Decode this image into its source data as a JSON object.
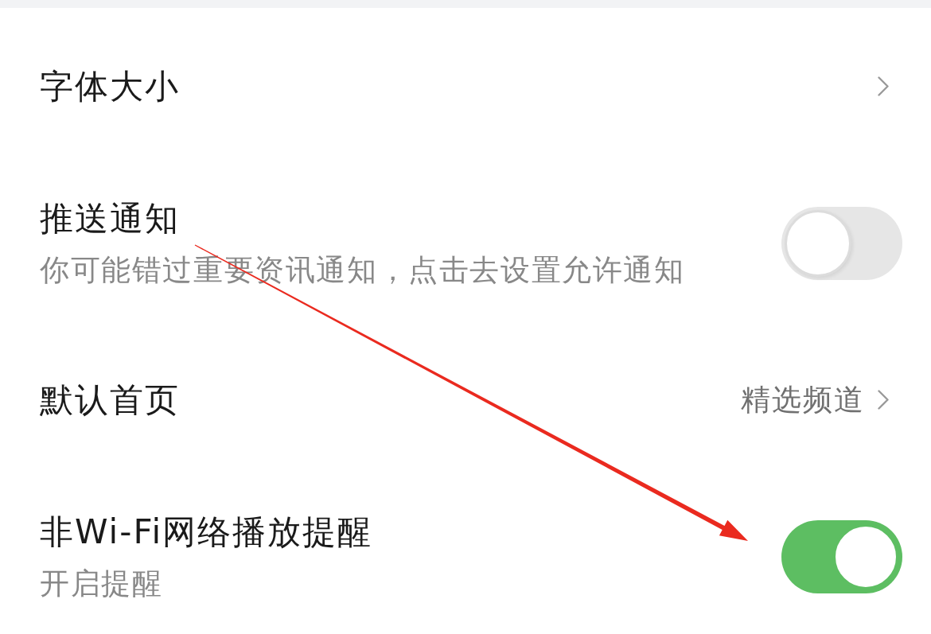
{
  "settings": [
    {
      "kind": "link",
      "title": "字体大小"
    },
    {
      "kind": "toggle",
      "title": "推送通知",
      "subtitle": "你可能错过重要资讯通知，点击去设置允许通知",
      "on": false
    },
    {
      "kind": "link",
      "title": "默认首页",
      "value": "精选频道"
    },
    {
      "kind": "toggle",
      "title": "非Wi-Fi网络播放提醒",
      "subtitle": "开启提醒",
      "on": true
    }
  ],
  "annotations": [
    {
      "kind": "arrow"
    }
  ]
}
